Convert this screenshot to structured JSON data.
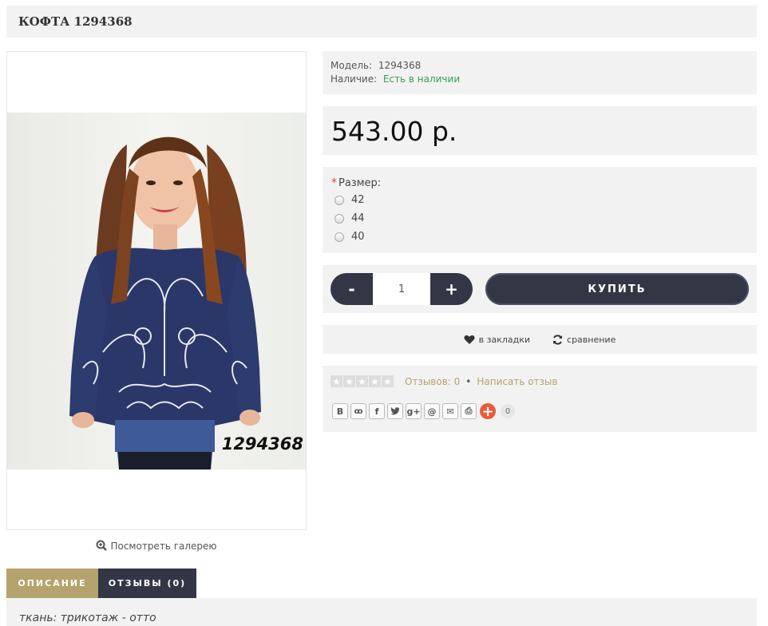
{
  "product": {
    "title": "КОФТА 1294368",
    "image_code": "1294368",
    "image_alt": "Кофта 1294368"
  },
  "gallery": {
    "label": "Посмотреть галерею",
    "icon": "zoom-in-icon"
  },
  "info": {
    "model_label": "Модель:",
    "model_value": "1294368",
    "stock_label": "Наличие:",
    "stock_value": "Есть в наличии",
    "stock_color": "#3a9c5a"
  },
  "price": "543.00 р.",
  "options": {
    "required_mark": "*",
    "label": "Размер:",
    "sizes": [
      "42",
      "44",
      "40"
    ]
  },
  "cart": {
    "minus": "-",
    "quantity": "1",
    "plus": "+",
    "buy_label": "КУПИТЬ"
  },
  "links": {
    "wishlist": "в закладки",
    "compare": "сравнение"
  },
  "reviews": {
    "rating": 0,
    "rating_max": 5,
    "count_text": "Отзывов: 0",
    "separator": "•",
    "write_text": "Написать отзыв"
  },
  "share": {
    "buttons": [
      {
        "label": "В",
        "name": "vk-share-button"
      },
      {
        "label": "ok",
        "name": "odnoklassniki-share-button"
      },
      {
        "label": "f",
        "name": "facebook-share-button"
      },
      {
        "label": "t",
        "name": "twitter-share-button"
      },
      {
        "label": "g+",
        "name": "googleplus-share-button"
      },
      {
        "label": "@",
        "name": "mailru-share-button"
      },
      {
        "label": "✉",
        "name": "email-share-button"
      },
      {
        "label": "⎙",
        "name": "print-share-button"
      }
    ],
    "more": "+",
    "count": "0"
  },
  "tabs": [
    {
      "label": "ОПИСАНИЕ",
      "active": true
    },
    {
      "label": "ОТЗЫВЫ (0)",
      "active": false
    }
  ],
  "description": "ткань: трикотаж - отто",
  "colors": {
    "accent": "#b5a36d",
    "dark": "#333645",
    "panel": "#f2f2f2",
    "share_plus": "#ea5a39"
  }
}
